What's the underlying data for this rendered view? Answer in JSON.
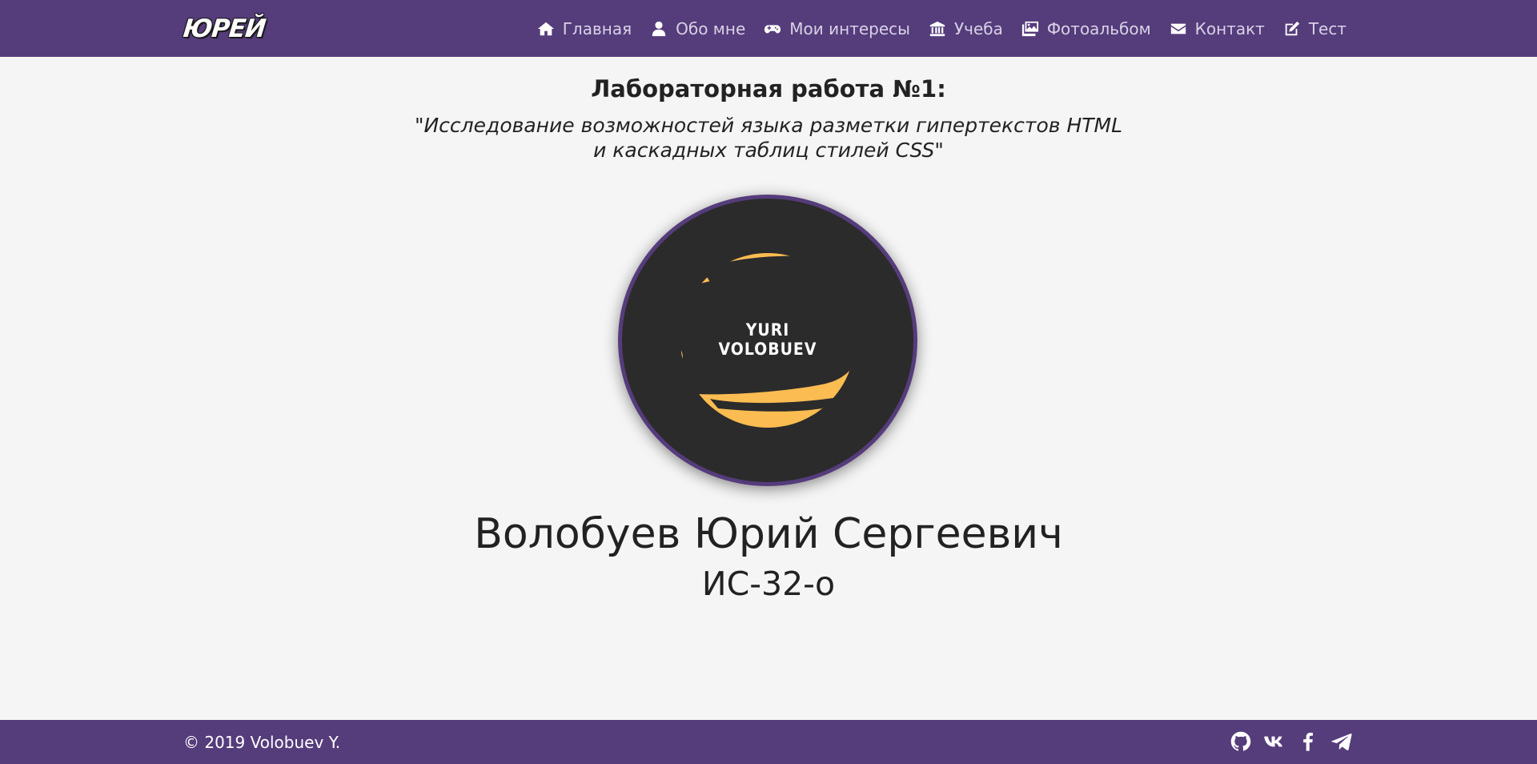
{
  "navbar": {
    "brand": "ЮРЕЙ",
    "items": [
      {
        "label": "Главная",
        "icon": "home-icon"
      },
      {
        "label": "Обо мне",
        "icon": "user-icon"
      },
      {
        "label": "Мои интересы",
        "icon": "gamepad-icon"
      },
      {
        "label": "Учеба",
        "icon": "university-icon"
      },
      {
        "label": "Фотоальбом",
        "icon": "images-icon"
      },
      {
        "label": "Контакт",
        "icon": "envelope-icon"
      },
      {
        "label": "Тест",
        "icon": "edit-icon"
      }
    ]
  },
  "main": {
    "title": "Лабораторная работа №1:",
    "subtitle_line1": "\"Исследование возможностей языка разметки гипертекстов HTML",
    "subtitle_line2": "и каскадных таблиц стилей CSS\"",
    "avatar_text_line1": "YURI",
    "avatar_text_line2": "VOLOBUEV",
    "name": "Волобуев Юрий Сергеевич",
    "group": "ИС-32-о"
  },
  "footer": {
    "copyright": "© 2019 Volobuev Y.",
    "social": [
      "github-icon",
      "vk-icon",
      "facebook-icon",
      "telegram-icon"
    ]
  },
  "colors": {
    "accent": "#553c7b",
    "background": "#f5f5f5",
    "avatar_bg": "#2b2b2b",
    "avatar_circle": "#fbbc51"
  }
}
